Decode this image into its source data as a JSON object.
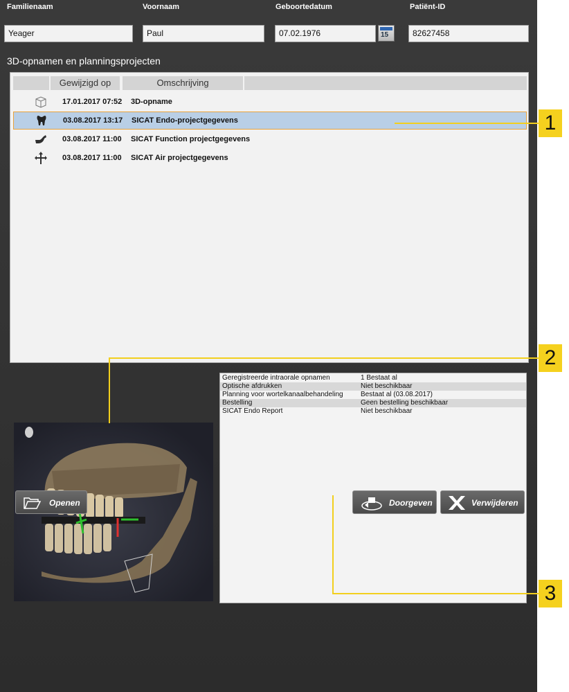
{
  "patient": {
    "familienaam_label": "Familienaam",
    "familienaam_value": "Yeager",
    "voornaam_label": "Voornaam",
    "voornaam_value": "Paul",
    "geboortedatum_label": "Geboortedatum",
    "geboortedatum_value": "07.02.1976",
    "calendar_day": "15",
    "patient_id_label": "Patiënt-ID",
    "patient_id_value": "82627458"
  },
  "list": {
    "title": "3D-opnamen en planningsprojecten",
    "columns": [
      "Gewijzigd op",
      "Omschrijving"
    ],
    "rows": [
      {
        "icon": "cube-icon",
        "date": "17.01.2017 07:52",
        "description": "3D-opname",
        "selected": false
      },
      {
        "icon": "tooth-icon",
        "date": "03.08.2017 13:17",
        "description": "SICAT Endo-projectgegevens",
        "selected": true
      },
      {
        "icon": "jaw-icon",
        "date": "03.08.2017 11:00",
        "description": "SICAT Function projectgegevens",
        "selected": false
      },
      {
        "icon": "airway-icon",
        "date": "03.08.2017 11:00",
        "description": "SICAT Air projectgegevens",
        "selected": false
      }
    ]
  },
  "details": {
    "rows": [
      {
        "key": "Geregistreerde intraorale opnamen",
        "value": "1 Bestaat al"
      },
      {
        "key": "Optische afdrukken",
        "value": "Niet beschikbaar"
      },
      {
        "key": "Planning voor wortelkanaalbehandeling",
        "value": "Bestaat al (03.08.2017)"
      },
      {
        "key": "Bestelling",
        "value": "Geen bestelling beschikbaar"
      },
      {
        "key": "SICAT Endo Report",
        "value": "Niet beschikbaar"
      }
    ]
  },
  "buttons": {
    "open": "Openen",
    "forward": "Doorgeven",
    "delete": "Verwijderen"
  },
  "callouts": [
    "1",
    "2",
    "3"
  ],
  "colors": {
    "selection_fill": "#b9cfe6",
    "selection_border": "#e8a23a",
    "callout": "#f5d11e"
  }
}
